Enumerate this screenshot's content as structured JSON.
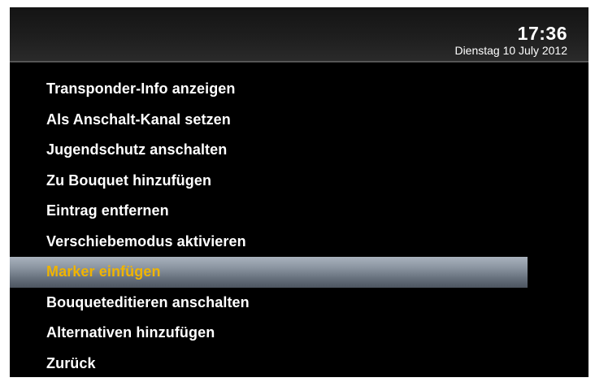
{
  "header": {
    "time": "17:36",
    "date": "Dienstag 10 July 2012"
  },
  "menu": {
    "selected_index": 6,
    "items": [
      {
        "label": "Transponder-Info anzeigen"
      },
      {
        "label": "Als Anschalt-Kanal setzen"
      },
      {
        "label": "Jugendschutz anschalten"
      },
      {
        "label": "Zu Bouquet hinzufügen"
      },
      {
        "label": "Eintrag entfernen"
      },
      {
        "label": "Verschiebemodus aktivieren"
      },
      {
        "label": "Marker einfügen"
      },
      {
        "label": "Bouqueteditieren anschalten"
      },
      {
        "label": "Alternativen hinzufügen"
      },
      {
        "label": "Zurück"
      }
    ]
  },
  "colors": {
    "background": "#000000",
    "text": "#ffffff",
    "selected_text": "#f0b400",
    "selection_bar": "#8b95a1"
  }
}
